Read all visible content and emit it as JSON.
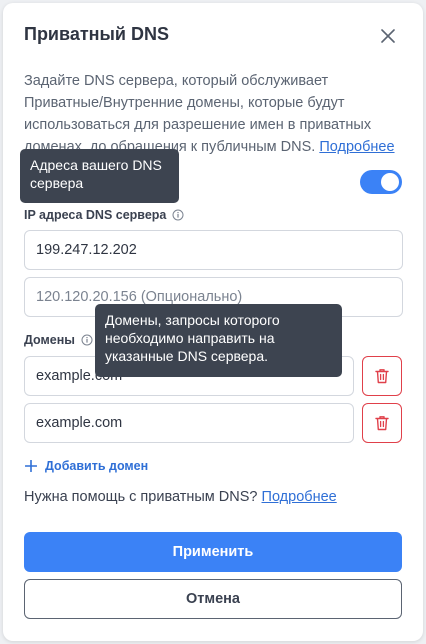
{
  "dialog": {
    "title": "Приватный DNS",
    "description": "Задайте DNS сервера, который обслуживает Приватные/Внутренние домены, которые будут использоваться для разрешение имен в приватных доменах, до обращения к публичным DNS.",
    "description_link": "Подробнее",
    "toggle_on": true
  },
  "ip_section": {
    "label": "IP адреса DNS сервера",
    "primary_value": "199.247.12.202",
    "secondary_placeholder": "120.120.20.156 (Опционально)"
  },
  "domains_section": {
    "label": "Домены",
    "items": [
      {
        "value": "example.com"
      },
      {
        "value": "example.com"
      }
    ],
    "add_label": "Добавить домен"
  },
  "help": {
    "text": "Нужна помощь с приватным DNS?",
    "link": "Подробнее"
  },
  "buttons": {
    "apply": "Применить",
    "cancel": "Отмена"
  },
  "tooltips": {
    "dns": "Адреса вашего DNS сервера",
    "domains": "Домены, запросы которого необходимо направить на указанные DNS сервера."
  },
  "colors": {
    "accent": "#3b82f6",
    "danger": "#e0404a",
    "tooltip_bg": "#3d4450"
  }
}
